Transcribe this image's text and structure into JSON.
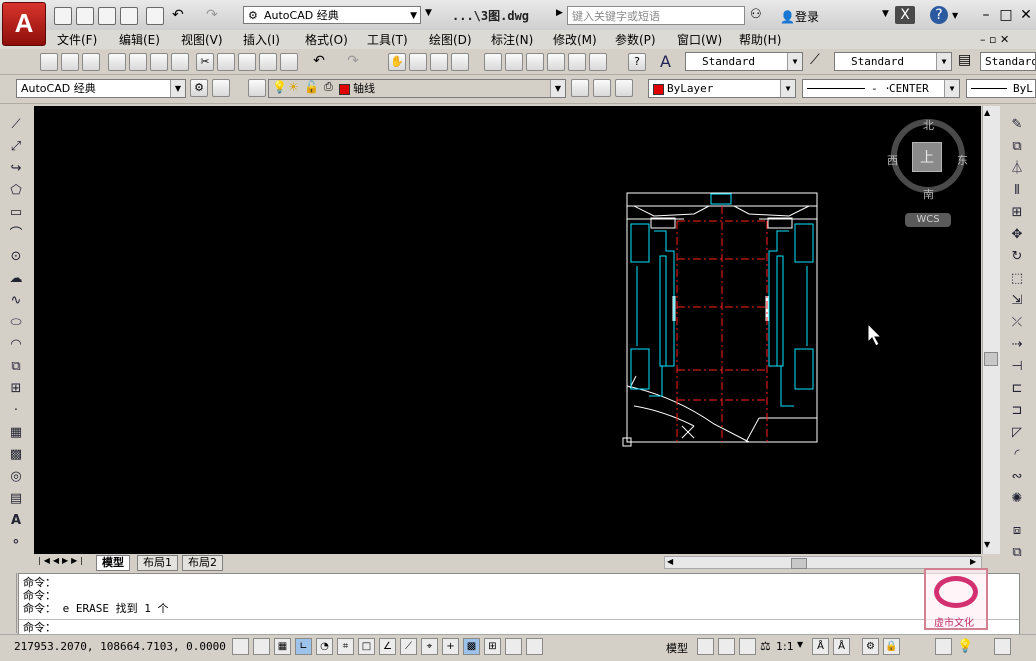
{
  "app": {
    "logo_letter": "A",
    "workspace": "AutoCAD 经典",
    "file_title": "...\\3图.dwg",
    "search_placeholder": "键入关键字或短语",
    "login": "登录"
  },
  "menu": [
    "文件(F)",
    "编辑(E)",
    "视图(V)",
    "插入(I)",
    "格式(O)",
    "工具(T)",
    "绘图(D)",
    "标注(N)",
    "修改(M)",
    "参数(P)",
    "窗口(W)",
    "帮助(H)"
  ],
  "styles": {
    "text_style": "Standard",
    "dim_style": "Standard",
    "table_style": "Standard"
  },
  "workspace_combo": "AutoCAD 经典",
  "layer": {
    "name": "轴线",
    "color": "#e00000"
  },
  "properties": {
    "color": "ByLayer",
    "linetype": "CENTER",
    "lineweight": "ByL"
  },
  "viewcube": {
    "north": "北",
    "south": "南",
    "east": "东",
    "west": "西",
    "top_label": "上",
    "wcs": "WCS"
  },
  "layout_tabs": [
    "模型",
    "布局1",
    "布局2"
  ],
  "command_lines": [
    "命令：",
    "命令：",
    "命令： e ERASE 找到 1 个"
  ],
  "command_prompt": "命令：",
  "status": {
    "coordinates": "217953.2070, 108664.7103, 0.0000",
    "model_label": "模型",
    "scale": "1:1"
  },
  "watermark": "虚市文化",
  "colors": {
    "canvas": "#000000",
    "wall": "#ffffff",
    "cyan": "#00e5ff",
    "axis": "#ff2020",
    "accent_red": "#c4231c"
  }
}
